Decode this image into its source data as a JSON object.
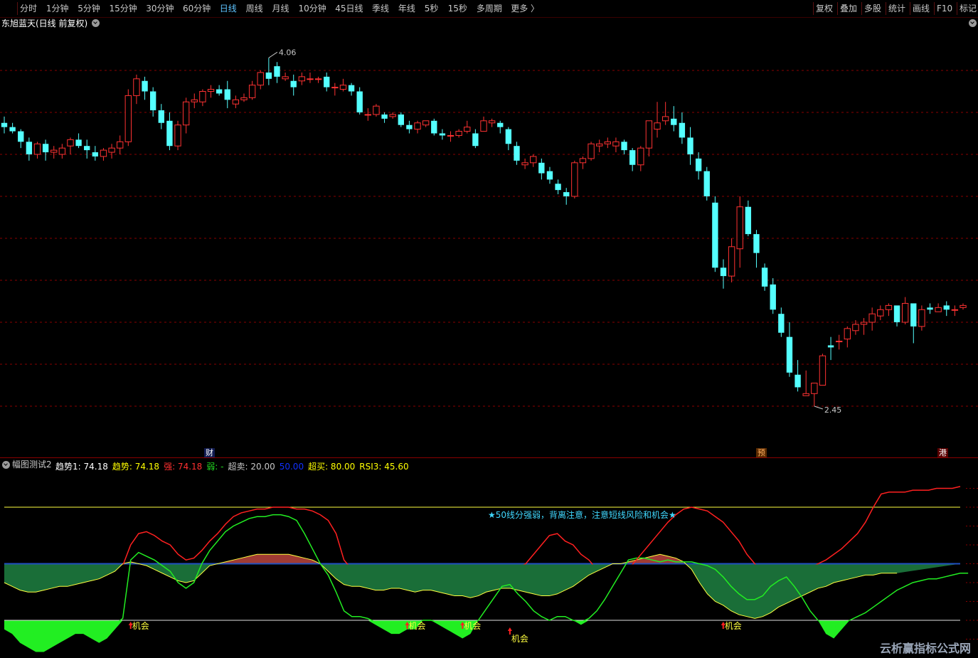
{
  "toolbar": {
    "periods": [
      {
        "label": "分时",
        "active": false
      },
      {
        "label": "1分钟",
        "active": false
      },
      {
        "label": "5分钟",
        "active": false
      },
      {
        "label": "15分钟",
        "active": false
      },
      {
        "label": "30分钟",
        "active": false
      },
      {
        "label": "60分钟",
        "active": false
      },
      {
        "label": "日线",
        "active": true
      },
      {
        "label": "周线",
        "active": false
      },
      {
        "label": "月线",
        "active": false
      },
      {
        "label": "10分钟",
        "active": false
      },
      {
        "label": "45日线",
        "active": false
      },
      {
        "label": "季线",
        "active": false
      },
      {
        "label": "年线",
        "active": false
      },
      {
        "label": "5秒",
        "active": false
      },
      {
        "label": "15秒",
        "active": false
      },
      {
        "label": "多周期",
        "active": false
      },
      {
        "label": "更多 〉",
        "active": false
      }
    ],
    "right_buttons": [
      "复权",
      "叠加",
      "多股",
      "统计",
      "画线",
      "F10",
      "标记"
    ]
  },
  "chart_title": "东旭蓝天(日线 前复权)",
  "price_labels": {
    "high": "4.06",
    "low": "2.45"
  },
  "event_markers": {
    "cai": "财",
    "yu": "预",
    "gang": "港"
  },
  "indicator": {
    "name": "幅图测试2",
    "items": [
      {
        "text": "趋势1: 74.18",
        "color": "#ffffff"
      },
      {
        "text": "趋势: 74.18",
        "color": "#ffff00"
      },
      {
        "text": "强: 74.18",
        "color": "#ff3030"
      },
      {
        "text": "弱: -",
        "color": "#22dd22"
      },
      {
        "text": "超卖: 20.00",
        "color": "#c8c8c8"
      },
      {
        "text": "50.00",
        "color": "#1030ff"
      },
      {
        "text": "超买: 80.00",
        "color": "#ffff00"
      },
      {
        "text": "RSI3: 45.60",
        "color": "#ffff00"
      }
    ],
    "note": "★50线分强弱，背离注意，注意短线风险和机会★",
    "signal_label": "机会"
  },
  "watermark": "云析赢指标公式网",
  "colors": {
    "up": "#ff3232",
    "down": "#54ffff",
    "grid": "#8a0000",
    "strong": "#ff2020",
    "weak": "#22ee22",
    "trend": "#ffff40",
    "mid": "#2050c0"
  },
  "chart_data": [
    {
      "type": "candlestick",
      "title": "东旭蓝天(日线 前复权)",
      "ylim": [
        2.2,
        4.2
      ],
      "annotations": [
        {
          "text": "4.06",
          "at": "max"
        },
        {
          "text": "2.45",
          "at": "min"
        }
      ],
      "ohlc": [
        [
          3.75,
          3.78,
          3.7,
          3.73
        ],
        [
          3.73,
          3.75,
          3.7,
          3.71
        ],
        [
          3.71,
          3.72,
          3.63,
          3.66
        ],
        [
          3.66,
          3.68,
          3.57,
          3.6
        ],
        [
          3.6,
          3.66,
          3.58,
          3.65
        ],
        [
          3.65,
          3.67,
          3.57,
          3.61
        ],
        [
          3.61,
          3.64,
          3.58,
          3.62
        ],
        [
          3.6,
          3.65,
          3.58,
          3.63
        ],
        [
          3.64,
          3.68,
          3.6,
          3.67
        ],
        [
          3.67,
          3.7,
          3.63,
          3.64
        ],
        [
          3.64,
          3.67,
          3.58,
          3.62
        ],
        [
          3.61,
          3.64,
          3.57,
          3.59
        ],
        [
          3.59,
          3.63,
          3.57,
          3.62
        ],
        [
          3.61,
          3.65,
          3.58,
          3.63
        ],
        [
          3.63,
          3.69,
          3.6,
          3.66
        ],
        [
          3.66,
          3.91,
          3.64,
          3.88
        ],
        [
          3.88,
          3.98,
          3.84,
          3.96
        ],
        [
          3.95,
          3.97,
          3.86,
          3.9
        ],
        [
          3.9,
          3.92,
          3.78,
          3.81
        ],
        [
          3.81,
          3.84,
          3.72,
          3.75
        ],
        [
          3.76,
          3.8,
          3.62,
          3.64
        ],
        [
          3.64,
          3.76,
          3.62,
          3.74
        ],
        [
          3.74,
          3.87,
          3.7,
          3.85
        ],
        [
          3.85,
          3.89,
          3.82,
          3.86
        ],
        [
          3.85,
          3.91,
          3.83,
          3.9
        ],
        [
          3.9,
          3.93,
          3.87,
          3.91
        ],
        [
          3.91,
          3.93,
          3.88,
          3.89
        ],
        [
          3.91,
          3.95,
          3.82,
          3.86
        ],
        [
          3.84,
          3.88,
          3.82,
          3.86
        ],
        [
          3.86,
          3.89,
          3.85,
          3.87
        ],
        [
          3.87,
          3.95,
          3.86,
          3.93
        ],
        [
          3.93,
          4.0,
          3.91,
          3.99
        ],
        [
          3.99,
          4.06,
          3.93,
          3.96
        ],
        [
          4.02,
          4.04,
          3.94,
          3.97
        ],
        [
          3.96,
          3.99,
          3.95,
          3.97
        ],
        [
          3.95,
          3.98,
          3.88,
          3.92
        ],
        [
          3.95,
          3.99,
          3.93,
          3.97
        ],
        [
          3.96,
          3.99,
          3.94,
          3.96
        ],
        [
          3.96,
          3.97,
          3.94,
          3.96
        ],
        [
          3.97,
          3.99,
          3.9,
          3.92
        ],
        [
          3.92,
          3.94,
          3.88,
          3.92
        ],
        [
          3.91,
          3.96,
          3.9,
          3.93
        ],
        [
          3.93,
          3.94,
          3.88,
          3.9
        ],
        [
          3.9,
          3.92,
          3.79,
          3.8
        ],
        [
          3.79,
          3.82,
          3.76,
          3.79
        ],
        [
          3.79,
          3.84,
          3.78,
          3.83
        ],
        [
          3.79,
          3.8,
          3.75,
          3.77
        ],
        [
          3.78,
          3.8,
          3.77,
          3.79
        ],
        [
          3.79,
          3.8,
          3.73,
          3.74
        ],
        [
          3.74,
          3.76,
          3.7,
          3.72
        ],
        [
          3.72,
          3.76,
          3.7,
          3.75
        ],
        [
          3.74,
          3.76,
          3.73,
          3.76
        ],
        [
          3.76,
          3.77,
          3.69,
          3.7
        ],
        [
          3.7,
          3.72,
          3.67,
          3.69
        ],
        [
          3.69,
          3.71,
          3.66,
          3.69
        ],
        [
          3.69,
          3.72,
          3.68,
          3.71
        ],
        [
          3.71,
          3.76,
          3.7,
          3.73
        ],
        [
          3.7,
          3.72,
          3.63,
          3.64
        ],
        [
          3.71,
          3.78,
          3.72,
          3.76
        ],
        [
          3.75,
          3.77,
          3.73,
          3.76
        ],
        [
          3.75,
          3.76,
          3.7,
          3.73
        ],
        [
          3.72,
          3.73,
          3.62,
          3.65
        ],
        [
          3.64,
          3.66,
          3.55,
          3.57
        ],
        [
          3.55,
          3.58,
          3.53,
          3.56
        ],
        [
          3.56,
          3.6,
          3.54,
          3.59
        ],
        [
          3.56,
          3.58,
          3.48,
          3.51
        ],
        [
          3.52,
          3.54,
          3.46,
          3.48
        ],
        [
          3.46,
          3.48,
          3.41,
          3.43
        ],
        [
          3.42,
          3.44,
          3.36,
          3.4
        ],
        [
          3.4,
          3.57,
          3.39,
          3.56
        ],
        [
          3.56,
          3.59,
          3.53,
          3.58
        ],
        [
          3.58,
          3.66,
          3.57,
          3.65
        ],
        [
          3.64,
          3.67,
          3.61,
          3.65
        ],
        [
          3.65,
          3.68,
          3.63,
          3.66
        ],
        [
          3.64,
          3.68,
          3.61,
          3.66
        ],
        [
          3.66,
          3.67,
          3.6,
          3.62
        ],
        [
          3.62,
          3.63,
          3.52,
          3.55
        ],
        [
          3.55,
          3.64,
          3.52,
          3.63
        ],
        [
          3.63,
          3.76,
          3.59,
          3.76
        ],
        [
          3.72,
          3.85,
          3.68,
          3.75
        ],
        [
          3.76,
          3.85,
          3.74,
          3.78
        ],
        [
          3.77,
          3.83,
          3.71,
          3.74
        ],
        [
          3.75,
          3.8,
          3.65,
          3.68
        ],
        [
          3.68,
          3.73,
          3.55,
          3.6
        ],
        [
          3.58,
          3.61,
          3.48,
          3.52
        ],
        [
          3.52,
          3.54,
          3.38,
          3.4
        ],
        [
          3.37,
          3.4,
          3.04,
          3.06
        ],
        [
          3.06,
          3.1,
          2.96,
          3.02
        ],
        [
          3.02,
          3.2,
          2.99,
          3.16
        ],
        [
          3.15,
          3.4,
          3.06,
          3.35
        ],
        [
          3.35,
          3.38,
          3.21,
          3.22
        ],
        [
          3.22,
          3.24,
          3.06,
          3.13
        ],
        [
          3.06,
          3.08,
          2.95,
          2.97
        ],
        [
          2.98,
          3.01,
          2.84,
          2.86
        ],
        [
          2.84,
          2.87,
          2.73,
          2.75
        ],
        [
          2.73,
          2.8,
          2.54,
          2.56
        ],
        [
          2.55,
          2.62,
          2.47,
          2.49
        ],
        [
          2.45,
          2.57,
          2.45,
          2.46
        ],
        [
          2.46,
          2.51,
          2.4,
          2.51
        ],
        [
          2.5,
          2.65,
          2.5,
          2.64
        ],
        [
          2.69,
          2.73,
          2.62,
          2.68
        ],
        [
          2.71,
          2.74,
          2.67,
          2.71
        ],
        [
          2.72,
          2.78,
          2.68,
          2.77
        ],
        [
          2.76,
          2.81,
          2.74,
          2.79
        ],
        [
          2.79,
          2.82,
          2.74,
          2.8
        ],
        [
          2.8,
          2.87,
          2.76,
          2.84
        ],
        [
          2.83,
          2.88,
          2.81,
          2.86
        ],
        [
          2.86,
          2.89,
          2.83,
          2.88
        ],
        [
          2.88,
          2.82,
          2.78,
          2.8
        ],
        [
          2.8,
          2.92,
          2.79,
          2.89
        ],
        [
          2.89,
          2.88,
          2.7,
          2.78
        ],
        [
          2.78,
          2.88,
          2.76,
          2.86
        ],
        [
          2.87,
          2.89,
          2.84,
          2.86
        ],
        [
          2.85,
          2.89,
          2.85,
          2.87
        ],
        [
          2.88,
          2.9,
          2.83,
          2.86
        ],
        [
          2.86,
          2.88,
          2.83,
          2.86
        ],
        [
          2.87,
          2.89,
          2.86,
          2.88
        ]
      ]
    },
    {
      "type": "line",
      "title": "幅图测试2",
      "ylim": [
        0,
        100
      ],
      "reference_lines": [
        {
          "name": "超卖",
          "value": 20
        },
        {
          "name": "50.00",
          "value": 50
        },
        {
          "name": "超买",
          "value": 80
        }
      ],
      "series": [
        {
          "name": "强",
          "values": [
            44,
            44,
            43,
            42,
            41,
            41,
            42,
            42,
            43,
            43,
            44,
            44,
            45,
            46,
            47,
            49,
            60,
            66,
            67,
            65,
            62,
            60,
            55,
            52,
            53,
            57,
            62,
            66,
            71,
            75,
            77,
            78,
            79,
            79,
            80,
            80,
            80,
            79,
            79,
            78,
            76,
            73,
            66,
            52,
            47,
            45,
            46,
            47,
            47,
            48,
            48,
            47,
            46,
            46,
            47,
            47,
            45,
            44,
            44,
            43,
            43,
            42,
            43,
            44,
            46,
            48,
            50,
            55,
            60,
            65,
            66,
            62,
            60,
            55,
            52,
            47,
            45,
            44,
            43,
            47,
            52,
            57,
            62,
            67,
            72,
            76,
            79,
            80,
            79,
            78,
            75,
            72,
            67,
            62,
            55,
            50,
            45,
            42,
            42,
            43,
            45,
            47,
            48,
            50,
            52,
            55,
            58,
            62,
            66,
            72,
            80,
            87,
            88,
            88,
            88,
            89,
            89,
            89,
            90,
            90,
            90,
            91
          ]
        },
        {
          "name": "弱",
          "values": [
            18,
            17,
            15,
            14,
            13,
            13,
            14,
            15,
            16,
            17,
            17,
            16,
            15,
            16,
            18,
            21,
            52,
            56,
            54,
            52,
            49,
            46,
            40,
            37,
            40,
            50,
            57,
            62,
            67,
            70,
            72,
            74,
            75,
            75,
            76,
            76,
            75,
            73,
            66,
            58,
            50,
            44,
            35,
            25,
            22,
            22,
            21,
            19,
            18,
            17,
            17,
            18,
            18,
            20,
            20,
            19,
            18,
            17,
            16,
            17,
            20,
            26,
            32,
            38,
            39,
            34,
            30,
            25,
            22,
            20,
            22,
            22,
            20,
            19,
            21,
            25,
            31,
            38,
            45,
            52,
            53,
            53,
            52,
            51,
            52,
            51,
            51,
            51,
            50,
            49,
            47,
            43,
            38,
            34,
            31,
            31,
            33,
            38,
            41,
            43,
            38,
            32,
            25,
            20,
            17,
            16,
            18,
            20,
            22,
            24,
            27,
            30,
            33,
            36,
            38,
            40,
            41,
            42,
            42,
            43,
            44,
            45,
            45
          ]
        },
        {
          "name": "趋势",
          "values": [
            40,
            38,
            36,
            35,
            35,
            36,
            37,
            38,
            38,
            39,
            40,
            41,
            42,
            44,
            46,
            50,
            51,
            50,
            49,
            47,
            45,
            43,
            41,
            40,
            41,
            45,
            49,
            50,
            51,
            52,
            53,
            54,
            55,
            55,
            55,
            55,
            55,
            54,
            53,
            52,
            50,
            46,
            42,
            39,
            38,
            38,
            37,
            36,
            36,
            37,
            37,
            36,
            35,
            36,
            36,
            35,
            34,
            33,
            33,
            32,
            33,
            35,
            36,
            37,
            37,
            36,
            35,
            34,
            33,
            33,
            34,
            36,
            38,
            41,
            44,
            46,
            48,
            50,
            50,
            51,
            52,
            53,
            54,
            55,
            54,
            53,
            51,
            47,
            40,
            34,
            30,
            28,
            25,
            23,
            22,
            21,
            22,
            24,
            27,
            29,
            31,
            33,
            35,
            37,
            38,
            40,
            41,
            42,
            43,
            44,
            44,
            45,
            45,
            45
          ]
        }
      ]
    }
  ]
}
